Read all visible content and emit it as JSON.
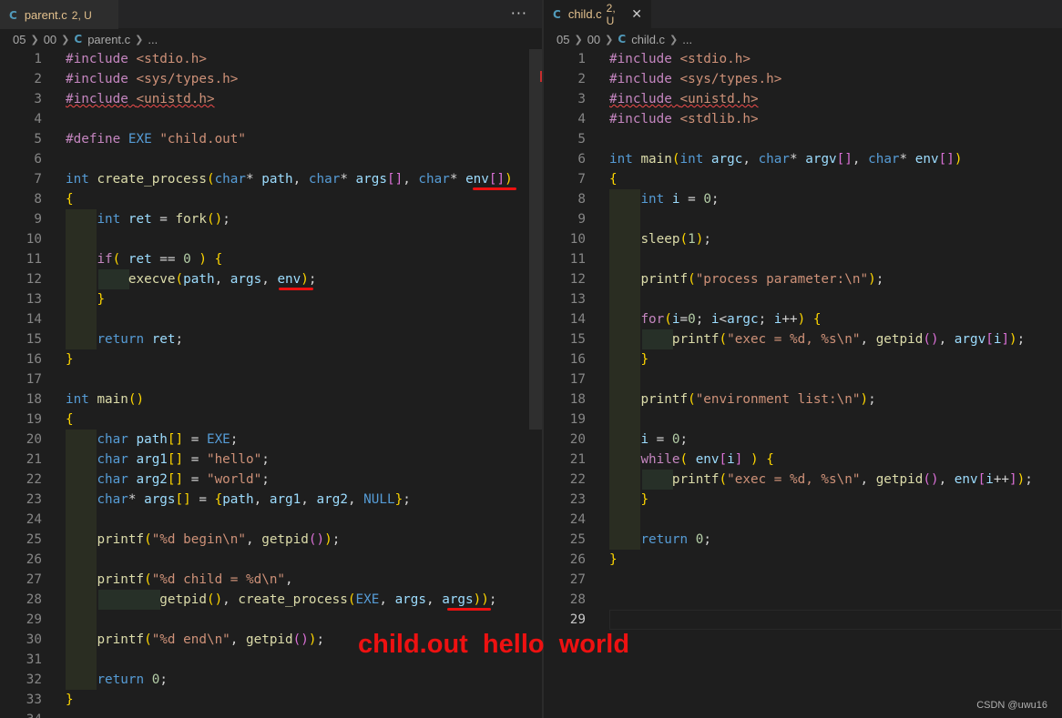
{
  "left_tab": {
    "icon": "C",
    "name": "parent.c",
    "badge": "2, U",
    "more": "···"
  },
  "right_tab": {
    "icon": "C",
    "name": "child.c",
    "badge": "2, U",
    "close": "✕"
  },
  "left_breadcrumb": {
    "p1": "05",
    "p2": "00",
    "file": "parent.c",
    "more": "..."
  },
  "right_breadcrumb": {
    "p1": "05",
    "p2": "00",
    "file": "child.c",
    "more": "..."
  },
  "annotation": "child.out  hello  world",
  "watermark": "CSDN @uwu16",
  "colors": {
    "error_red": "#ee1111",
    "tab_modified": "#e2c08d",
    "c_icon": "#519aba"
  },
  "left_lines": [
    [
      "1",
      "#include <stdio.h>"
    ],
    [
      "2",
      "#include <sys/types.h>"
    ],
    [
      "3",
      "#include <unistd.h>"
    ],
    [
      "4",
      ""
    ],
    [
      "5",
      "#define EXE \"child.out\""
    ],
    [
      "6",
      ""
    ],
    [
      "7",
      "int create_process(char* path, char* args[], char* env[])"
    ],
    [
      "8",
      "{"
    ],
    [
      "9",
      "    int ret = fork();"
    ],
    [
      "10",
      ""
    ],
    [
      "11",
      "    if( ret == 0 ) {"
    ],
    [
      "12",
      "        execve(path, args, env);"
    ],
    [
      "13",
      "    }"
    ],
    [
      "14",
      ""
    ],
    [
      "15",
      "    return ret;"
    ],
    [
      "16",
      "}"
    ],
    [
      "17",
      ""
    ],
    [
      "18",
      "int main()"
    ],
    [
      "19",
      "{"
    ],
    [
      "20",
      "    char path[] = EXE;"
    ],
    [
      "21",
      "    char arg1[] = \"hello\";"
    ],
    [
      "22",
      "    char arg2[] = \"world\";"
    ],
    [
      "23",
      "    char* args[] = {path, arg1, arg2, NULL};"
    ],
    [
      "24",
      ""
    ],
    [
      "25",
      "    printf(\"%d begin\\n\", getpid());"
    ],
    [
      "26",
      ""
    ],
    [
      "27",
      "    printf(\"%d child = %d\\n\","
    ],
    [
      "28",
      "            getpid(), create_process(EXE, args, args));"
    ],
    [
      "29",
      ""
    ],
    [
      "30",
      "    printf(\"%d end\\n\", getpid());"
    ],
    [
      "31",
      ""
    ],
    [
      "32",
      "    return 0;"
    ],
    [
      "33",
      "}"
    ],
    [
      "34",
      ""
    ]
  ],
  "right_lines": [
    [
      "1",
      "#include <stdio.h>"
    ],
    [
      "2",
      "#include <sys/types.h>"
    ],
    [
      "3",
      "#include <unistd.h>"
    ],
    [
      "4",
      "#include <stdlib.h>"
    ],
    [
      "5",
      ""
    ],
    [
      "6",
      "int main(int argc, char* argv[], char* env[])"
    ],
    [
      "7",
      "{"
    ],
    [
      "8",
      "    int i = 0;"
    ],
    [
      "9",
      ""
    ],
    [
      "10",
      "    sleep(1);"
    ],
    [
      "11",
      ""
    ],
    [
      "12",
      "    printf(\"process parameter:\\n\");"
    ],
    [
      "13",
      ""
    ],
    [
      "14",
      "    for(i=0; i<argc; i++) {"
    ],
    [
      "15",
      "        printf(\"exec = %d, %s\\n\", getpid(), argv[i]);"
    ],
    [
      "16",
      "    }"
    ],
    [
      "17",
      ""
    ],
    [
      "18",
      "    printf(\"environment list:\\n\");"
    ],
    [
      "19",
      ""
    ],
    [
      "20",
      "    i = 0;"
    ],
    [
      "21",
      "    while( env[i] ) {"
    ],
    [
      "22",
      "        printf(\"exec = %d, %s\\n\", getpid(), env[i++]);"
    ],
    [
      "23",
      "    }"
    ],
    [
      "24",
      ""
    ],
    [
      "25",
      "    return 0;"
    ],
    [
      "26",
      "}"
    ],
    [
      "27",
      ""
    ],
    [
      "28",
      ""
    ],
    [
      "29",
      ""
    ]
  ]
}
